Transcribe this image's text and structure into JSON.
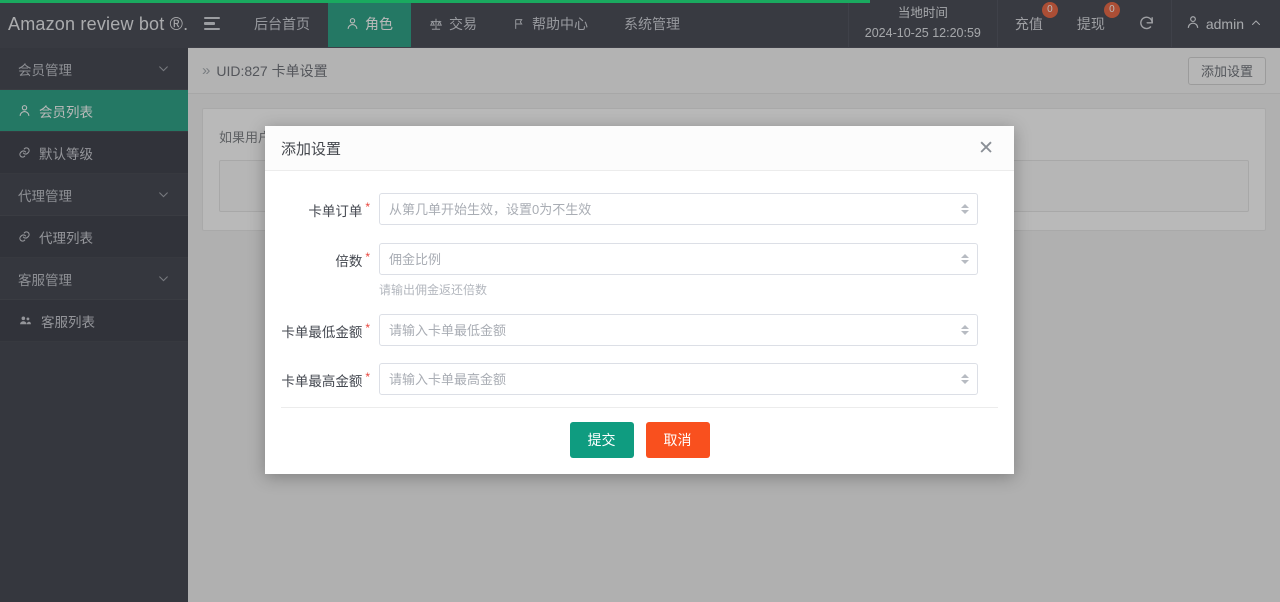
{
  "header": {
    "logo": "Amazon review bot ®...",
    "menu_icon": "hamburger-icon",
    "nav": [
      {
        "label": "后台首页",
        "icon": "",
        "active": false
      },
      {
        "label": "角色",
        "icon": "user-icon",
        "active": true
      },
      {
        "label": "交易",
        "icon": "scales-icon",
        "active": false
      },
      {
        "label": "帮助中心",
        "icon": "flag-icon",
        "active": false
      },
      {
        "label": "系统管理",
        "icon": "",
        "active": false
      }
    ],
    "clock_label": "当地时间",
    "clock_value": "2024-10-25 12:20:59",
    "recharge": {
      "label": "充值",
      "badge": "0"
    },
    "withdraw": {
      "label": "提现",
      "badge": "0"
    },
    "refresh_icon": "refresh-icon",
    "user": {
      "name": "admin",
      "icon": "user-icon",
      "caret": "chevron-up-icon"
    }
  },
  "sidebar": {
    "items": [
      {
        "label": "会员管理",
        "type": "group",
        "icon": "",
        "active": false
      },
      {
        "label": "会员列表",
        "type": "item",
        "icon": "user-icon",
        "active": true
      },
      {
        "label": "默认等级",
        "type": "item",
        "icon": "link-icon",
        "active": false
      },
      {
        "label": "代理管理",
        "type": "group",
        "icon": "",
        "active": false
      },
      {
        "label": "代理列表",
        "type": "item",
        "icon": "link-icon",
        "active": false
      },
      {
        "label": "客服管理",
        "type": "group",
        "icon": "",
        "active": false
      },
      {
        "label": "客服列表",
        "type": "item",
        "icon": "users-icon",
        "active": false
      }
    ]
  },
  "breadcrumb": {
    "separator": "»",
    "text": "UID:827 卡单设置"
  },
  "page_actions": {
    "add_setting": "添加设置"
  },
  "background_panel": {
    "note": "如果用户"
  },
  "modal": {
    "title": "添加设置",
    "close_icon": "close-icon",
    "fields": [
      {
        "label": "卡单订单",
        "required": "*",
        "placeholder": "从第几单开始生效，设置0为不生效",
        "value": "",
        "help": ""
      },
      {
        "label": "倍数",
        "required": "*",
        "placeholder": "佣金比例",
        "value": "",
        "help": "请输出佣金返还倍数"
      },
      {
        "label": "卡单最低金额",
        "required": "*",
        "placeholder": "请输入卡单最低金额",
        "value": "",
        "help": ""
      },
      {
        "label": "卡单最高金额",
        "required": "*",
        "placeholder": "请输入卡单最高金额",
        "value": "",
        "help": ""
      }
    ],
    "submit_label": "提交",
    "cancel_label": "取消"
  },
  "colors": {
    "accent_green": "#0f9776",
    "submit_green": "#0f9c80",
    "cancel_orange": "#f9501e",
    "badge_red": "#e8532a",
    "header_dark": "#2f323e",
    "sidebar_dark": "#2b2e39",
    "required_red": "#e8453c",
    "progress_green": "#1aa95f"
  }
}
